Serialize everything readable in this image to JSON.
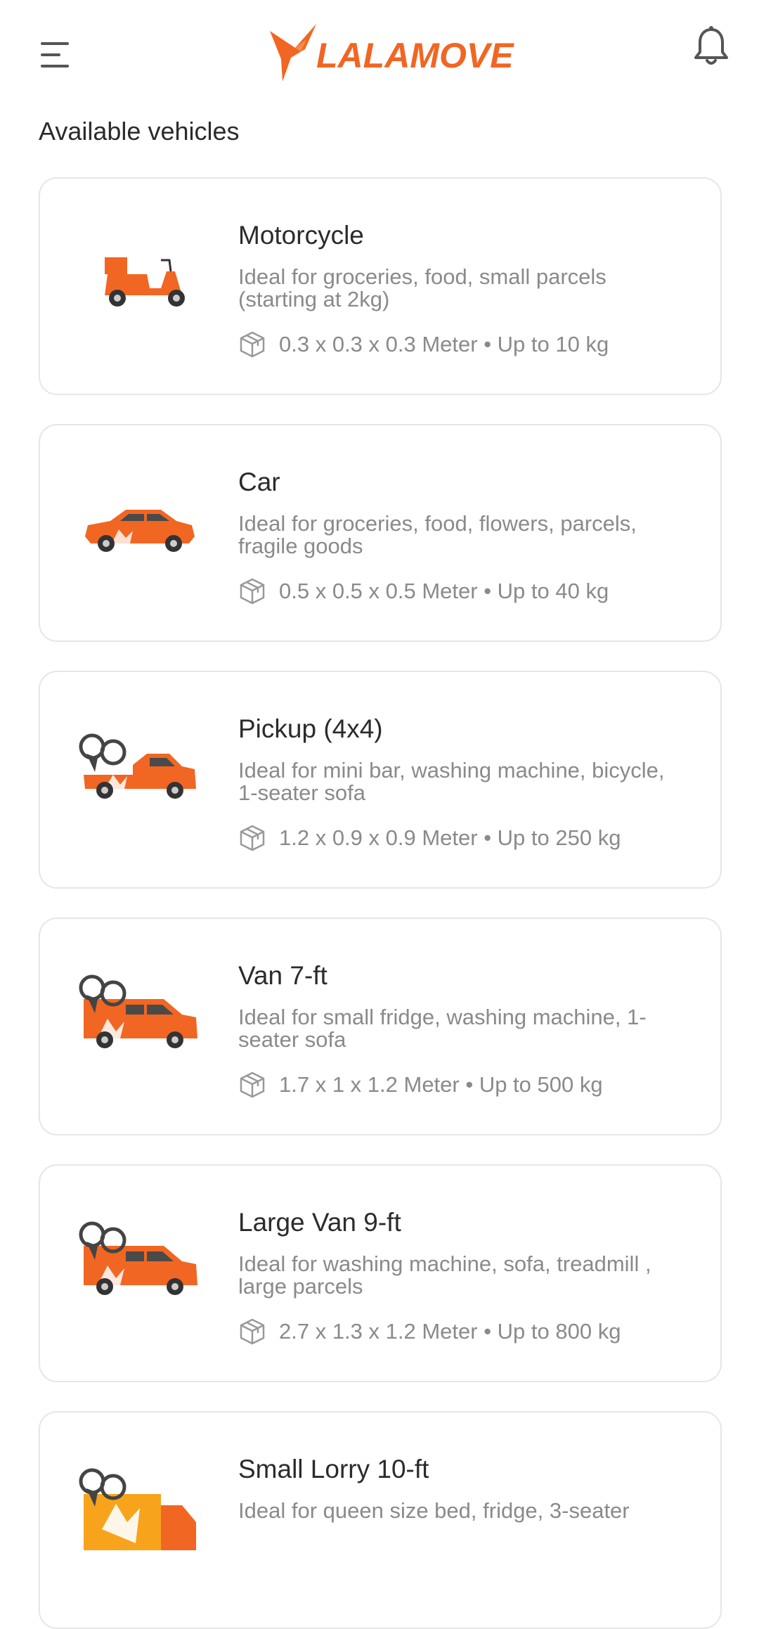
{
  "header": {
    "brand": "LALAMOVE",
    "menu_icon": "hamburger-menu-icon",
    "notification_icon": "bell-icon",
    "brand_color": "#f16622"
  },
  "section_title": "Available vehicles",
  "vehicles": [
    {
      "name": "Motorcycle",
      "description": "Ideal for groceries, food, small parcels (starting at 2kg)",
      "spec": "0.3 x 0.3 x 0.3 Meter • Up to 10 kg",
      "icon": "motorcycle-icon"
    },
    {
      "name": "Car",
      "description": "Ideal for groceries, food, flowers, parcels, fragile goods",
      "spec": "0.5 x 0.5 x 0.5 Meter • Up to 40 kg",
      "icon": "car-icon"
    },
    {
      "name": "Pickup (4x4)",
      "description": "Ideal for mini bar, washing machine, bicycle, 1-seater sofa",
      "spec": "1.2 x 0.9 x 0.9 Meter • Up to 250 kg",
      "icon": "pickup-truck-icon"
    },
    {
      "name": "Van 7-ft",
      "description": "Ideal for small fridge, washing machine, 1-seater sofa",
      "spec": "1.7 x 1 x 1.2 Meter • Up to 500 kg",
      "icon": "van-icon"
    },
    {
      "name": "Large Van 9-ft",
      "description": "Ideal for washing machine, sofa, treadmill , large parcels",
      "spec": "2.7 x 1.3 x 1.2 Meter • Up to 800 kg",
      "icon": "large-van-icon"
    },
    {
      "name": "Small Lorry 10-ft",
      "description": "Ideal for queen size bed, fridge, 3-seater",
      "spec": "",
      "icon": "small-lorry-icon"
    }
  ]
}
